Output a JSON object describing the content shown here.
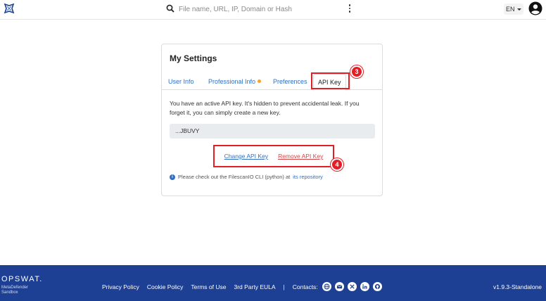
{
  "header": {
    "search_placeholder": "File name, URL, IP, Domain or Hash",
    "language": "EN"
  },
  "settings": {
    "title": "My Settings",
    "tabs": [
      {
        "label": "User Info"
      },
      {
        "label": "Professional Info"
      },
      {
        "label": "Preferences"
      },
      {
        "label": "API Key",
        "active": true
      }
    ],
    "description": "You have an active API key. It's hidden to prevent accidental leak. If you forget it, you can simply create a new key.",
    "api_key_masked": "...JBUVY",
    "change_label": "Change API Key",
    "remove_label": "Remove API Key",
    "info_text": "Please check out the FilescanIO CLI (python) at",
    "info_link": "its repository"
  },
  "annotations": {
    "step_tab": "3",
    "step_actions": "4",
    "highlight_color": "#e21e26"
  },
  "footer": {
    "brand": "OPSWAT.",
    "brand_sub_1": "MetaDefender",
    "brand_sub_2": "Sandbox",
    "links": [
      "Privacy Policy",
      "Cookie Policy",
      "Terms of Use",
      "3rd Party EULA"
    ],
    "separator": "|",
    "contacts_label": "Contacts:",
    "contact_icons": [
      "globe-icon",
      "email-icon",
      "x-icon",
      "linkedin-icon",
      "github-icon"
    ],
    "version": "v1.9.3-Standalone",
    "background": "#1d3f94"
  }
}
